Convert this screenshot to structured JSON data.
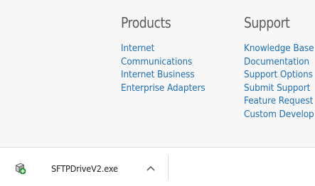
{
  "footer": {
    "products": {
      "heading": "Products",
      "links": [
        {
          "label": "Internet"
        },
        {
          "label": "Communications"
        },
        {
          "label": "Internet Business"
        },
        {
          "label": "Enterprise Adapters"
        }
      ]
    },
    "support": {
      "heading": "Support",
      "links": [
        {
          "label": "Knowledge Base"
        },
        {
          "label": "Documentation"
        },
        {
          "label": "Support Options"
        },
        {
          "label": "Submit Support"
        },
        {
          "label": "Feature Request"
        },
        {
          "label": "Custom Develop"
        }
      ]
    },
    "colors": {
      "background": "#f7f7f8",
      "heading": "#5a5a5a",
      "link": "#1f6fb2"
    }
  },
  "download_bar": {
    "items": [
      {
        "file_name": "SFTPDriveV2.exe",
        "icon": "installer-file-icon",
        "menu_icon": "chevron-up-icon"
      }
    ]
  }
}
